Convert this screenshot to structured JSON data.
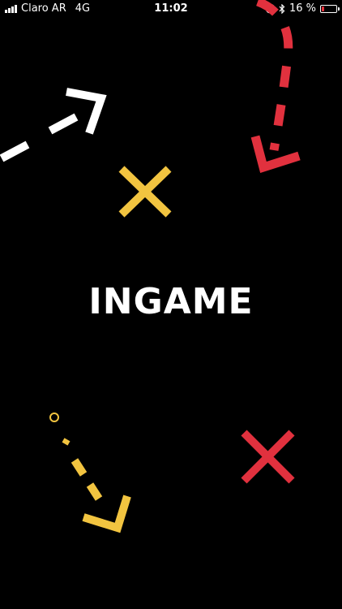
{
  "status_bar": {
    "carrier": "Claro AR",
    "network": "4G",
    "time": "11:02",
    "battery_text": "16 %",
    "battery_level": 0.16,
    "alarm_icon": "alarm-icon",
    "bluetooth_icon": "bluetooth-icon",
    "signal_icon": "signal-bars-icon"
  },
  "splash": {
    "title": "INGAME"
  },
  "colors": {
    "background": "#000000",
    "red": "#e1313e",
    "yellow": "#f2c440",
    "white": "#ffffff",
    "battery_low": "#e8323c"
  }
}
